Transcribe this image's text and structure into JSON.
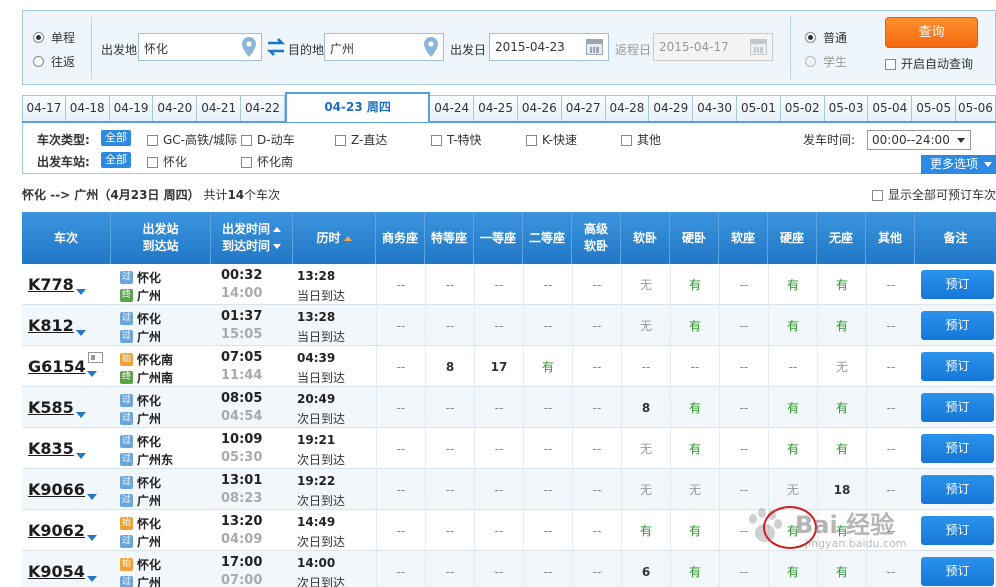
{
  "trip": {
    "one_way": "单程",
    "round_trip": "往返"
  },
  "from": {
    "label": "出发地",
    "value": "怀化"
  },
  "to": {
    "label": "目的地",
    "value": "广州"
  },
  "depart": {
    "label": "出发日",
    "value": "2015-04-23"
  },
  "return_date": {
    "label": "返程日",
    "value": "2015-04-17"
  },
  "passenger": {
    "normal": "普通",
    "student": "学生"
  },
  "query_button": "查询",
  "auto_query": "开启自动查询",
  "date_tabs_before": [
    "04-17",
    "04-18",
    "04-19",
    "04-20",
    "04-21",
    "04-22"
  ],
  "date_tab_active": "04-23 周四",
  "date_tabs_after": [
    "04-24",
    "04-25",
    "04-26",
    "04-27",
    "04-28",
    "04-29",
    "04-30",
    "05-01",
    "05-02",
    "05-03",
    "05-04",
    "05-05",
    "05-06"
  ],
  "filters": {
    "type_label": "车次类型:",
    "station_label": "出发车站:",
    "all": "全部",
    "types": [
      "GC-高铁/城际",
      "D-动车",
      "Z-直达",
      "T-特快",
      "K-快速",
      "其他"
    ],
    "stations": [
      "怀化",
      "怀化南"
    ],
    "time_label": "发车时间:",
    "time_value": "00:00--24:00",
    "more_button": "更多选项"
  },
  "summary": {
    "route": "怀化 --> 广州",
    "date": "（4月23日 周四）",
    "total_prefix": "共计",
    "count": "14",
    "total_suffix": "个车次"
  },
  "show_all": "显示全部可预订车次",
  "header": {
    "train": "车次",
    "station_from": "出发站",
    "station_to": "到达站",
    "dep_time": "出发时间",
    "arr_time": "到达时间",
    "duration": "历时",
    "seats": [
      "商务座",
      "特等座",
      "一等座",
      "二等座",
      "高级",
      "软卧",
      "硬卧",
      "软座",
      "硬座",
      "无座",
      "其他"
    ],
    "seat_premium_sub": "软卧",
    "remark": "备注"
  },
  "rows": [
    {
      "train": "K778",
      "from_badge": "过",
      "from": "怀化",
      "to_badge": "终",
      "to": "广州",
      "dep": "00:32",
      "arr": "14:00",
      "dur": "13:28",
      "arrive_day": "当日到达",
      "seats": [
        "--",
        "--",
        "--",
        "--",
        "--",
        "无",
        "有",
        "--",
        "有",
        "有",
        "--"
      ],
      "book": "预订"
    },
    {
      "train": "K812",
      "from_badge": "过",
      "from": "怀化",
      "to_badge": "过",
      "to": "广州",
      "dep": "01:37",
      "arr": "15:05",
      "dur": "13:28",
      "arrive_day": "当日到达",
      "seats": [
        "--",
        "--",
        "--",
        "--",
        "--",
        "无",
        "有",
        "--",
        "有",
        "有",
        "--"
      ],
      "book": "预订"
    },
    {
      "train": "G6154",
      "from_badge": "始",
      "from": "怀化南",
      "to_badge": "终",
      "to": "广州南",
      "dep": "07:05",
      "arr": "11:44",
      "dur": "04:39",
      "arrive_day": "当日到达",
      "seats": [
        "--",
        "8",
        "17",
        "有",
        "--",
        "--",
        "--",
        "--",
        "--",
        "无",
        "--"
      ],
      "book": "预订"
    },
    {
      "train": "K585",
      "from_badge": "过",
      "from": "怀化",
      "to_badge": "过",
      "to": "广州",
      "dep": "08:05",
      "arr": "04:54",
      "dur": "20:49",
      "arrive_day": "次日到达",
      "seats": [
        "--",
        "--",
        "--",
        "--",
        "--",
        "8",
        "有",
        "--",
        "有",
        "有",
        "--"
      ],
      "book": "预订"
    },
    {
      "train": "K835",
      "from_badge": "过",
      "from": "怀化",
      "to_badge": "过",
      "to": "广州东",
      "dep": "10:09",
      "arr": "05:30",
      "dur": "19:21",
      "arrive_day": "次日到达",
      "seats": [
        "--",
        "--",
        "--",
        "--",
        "--",
        "无",
        "有",
        "--",
        "有",
        "有",
        "--"
      ],
      "book": "预订"
    },
    {
      "train": "K9066",
      "from_badge": "过",
      "from": "怀化",
      "to_badge": "过",
      "to": "广州",
      "dep": "13:01",
      "arr": "08:23",
      "dur": "19:22",
      "arrive_day": "次日到达",
      "seats": [
        "--",
        "--",
        "--",
        "--",
        "--",
        "无",
        "无",
        "--",
        "无",
        "18",
        "--"
      ],
      "book": "预订"
    },
    {
      "train": "K9062",
      "from_badge": "始",
      "from": "怀化",
      "to_badge": "过",
      "to": "广州",
      "dep": "13:20",
      "arr": "04:09",
      "dur": "14:49",
      "arrive_day": "次日到达",
      "seats": [
        "--",
        "--",
        "--",
        "--",
        "--",
        "有",
        "有",
        "--",
        "有",
        "有",
        "--"
      ],
      "book": "预订"
    },
    {
      "train": "K9054",
      "from_badge": "始",
      "from": "怀化",
      "to_badge": "过",
      "to": "广州",
      "dep": "17:00",
      "arr": "07:00",
      "dur": "14:00",
      "arrive_day": "次日到达",
      "seats": [
        "--",
        "--",
        "--",
        "--",
        "--",
        "6",
        "有",
        "--",
        "有",
        "有",
        "--"
      ],
      "book": "预订"
    }
  ],
  "watermark": {
    "text": "Bai 经验",
    "sub": "jingyan.baidu.com"
  },
  "colors": {
    "accent": "#2d8ae3",
    "query": "#f5680f",
    "available": "#2a9a2a",
    "header": "#2177c7"
  }
}
